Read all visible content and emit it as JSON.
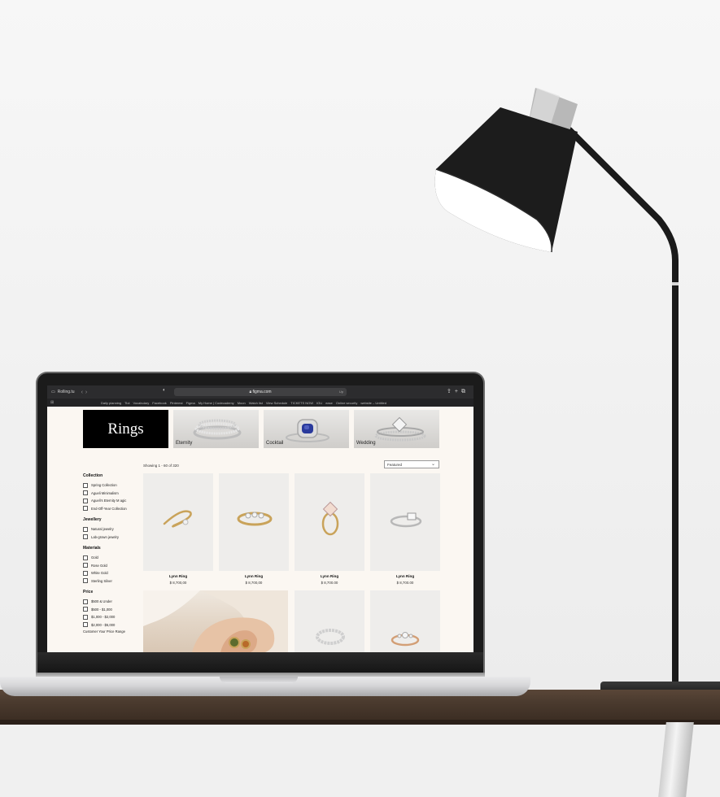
{
  "browser": {
    "tab_title": "Rolling.tu",
    "url": "figma.com",
    "url_extra": "Up",
    "bookmarks": [
      "Daily planning",
      "Tiol",
      "Vocabulary",
      "Facebook",
      "Pinterest",
      "Figma",
      "My Home | Codecademy",
      "Moon",
      "Watch list",
      "View Schedule",
      "TICKETS NOW",
      "IOU",
      "ease",
      "Online security",
      "website – Untitled"
    ]
  },
  "page": {
    "hero_title": "Rings",
    "categories": [
      {
        "label": "Eternity"
      },
      {
        "label": "Cocktail"
      },
      {
        "label": "Wedding"
      }
    ],
    "showing_text": "Showing 1 - 60 of 320",
    "sort_value": "Featured",
    "filters": {
      "collection": {
        "heading": "Collection",
        "items": [
          "Spring Collection",
          "Agueli Minimalism",
          "Agueli's Eternity M agic",
          "End-Off-Year Collection"
        ]
      },
      "jewellery": {
        "heading": "Jewellery",
        "items": [
          "Natural jewelry",
          "Lab-grown jewelry"
        ]
      },
      "materials": {
        "heading": "Materials",
        "items": [
          "Gold",
          "Rose Gold",
          "White Gold",
          "Sterling Silver"
        ]
      },
      "price": {
        "heading": "Price",
        "items": [
          "$500 & Under",
          "$500 - $1,000",
          "$1,000 - $2,000",
          "$2,000 - $5,000"
        ],
        "custom": "Customer Your Price Range"
      }
    },
    "products": [
      {
        "name": "Lynn Ring",
        "price": "$ 8,700,00"
      },
      {
        "name": "Lynn Ring",
        "price": "$ 8,700,00"
      },
      {
        "name": "Lynn Ring",
        "price": "$ 8,700.00"
      },
      {
        "name": "Lynn Ring",
        "price": "$ 8,700.00"
      }
    ]
  },
  "colors": {
    "page_bg": "#fbf7f2",
    "hero_bg": "#000000",
    "chrome_bg": "#2c2c2e",
    "gold": "#c9a35a",
    "sapphire": "#2a3a9c"
  },
  "icons": [
    "sidebar-icon",
    "back-chevron-icon",
    "forward-chevron-icon",
    "privacy-shield-icon",
    "lock-icon",
    "share-icon",
    "new-tab-icon",
    "tabs-icon",
    "chevron-down-icon"
  ]
}
